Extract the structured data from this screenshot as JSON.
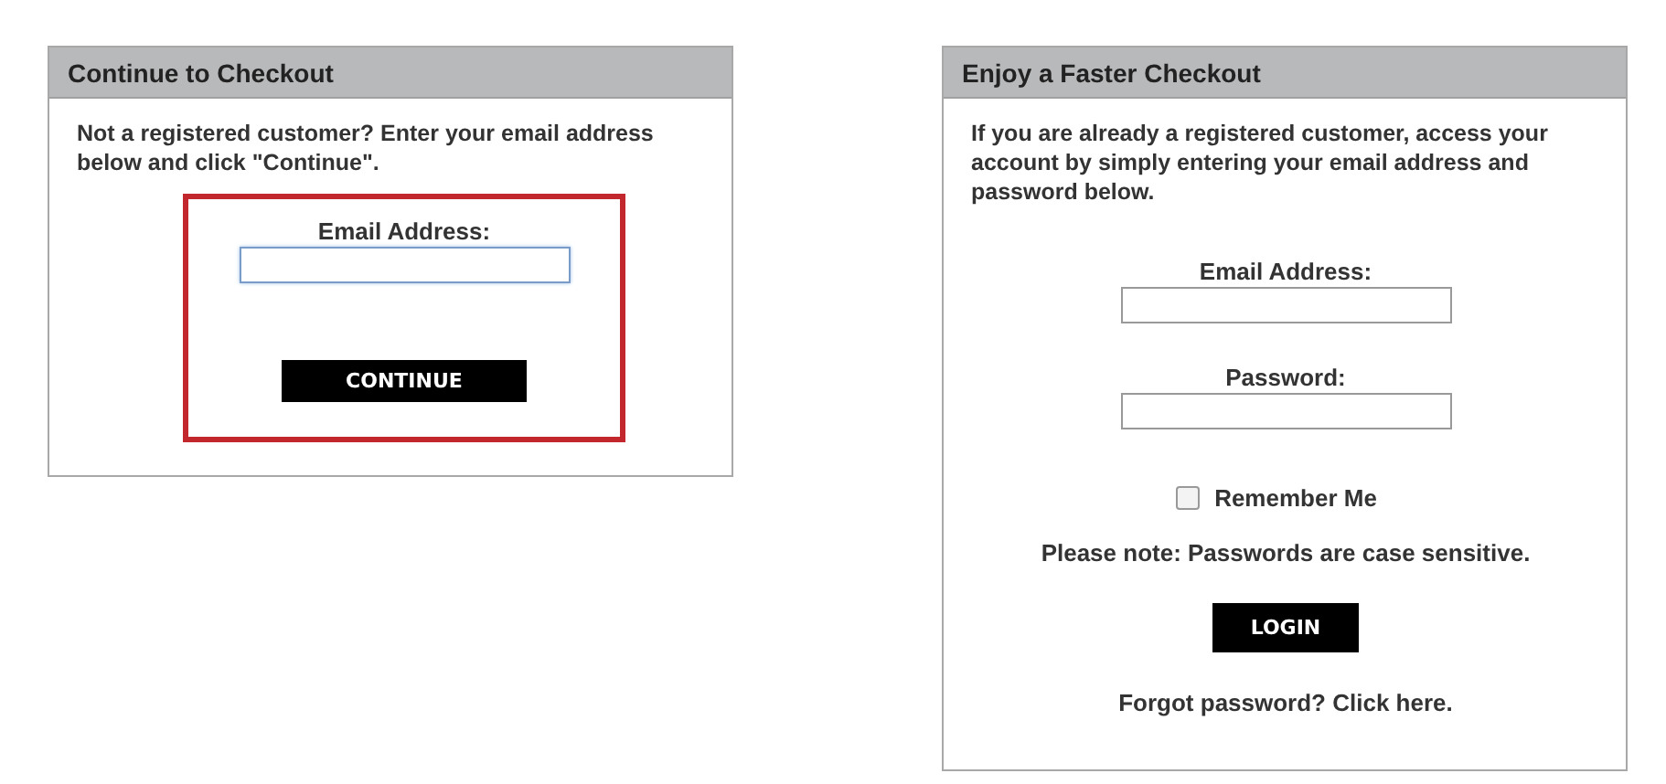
{
  "guest_panel": {
    "title": "Continue to Checkout",
    "intro": "Not a registered customer? Enter your email address below and click \"Continue\".",
    "highlighted": true,
    "email_label": "Email Address:",
    "email_focused": true,
    "button": "CONTINUE"
  },
  "login_panel": {
    "title": "Enjoy a Faster Checkout",
    "intro": "If you are already a registered customer, access your account by simply entering your email address and password below.",
    "email_label": "Email Address:",
    "password_label": "Password:",
    "remember": {
      "label": "Remember Me",
      "checked": false
    },
    "note": "Please note: Passwords are case sensitive.",
    "button": "LOGIN",
    "forgot": "Forgot password?",
    "forgot_link": "Click here."
  }
}
